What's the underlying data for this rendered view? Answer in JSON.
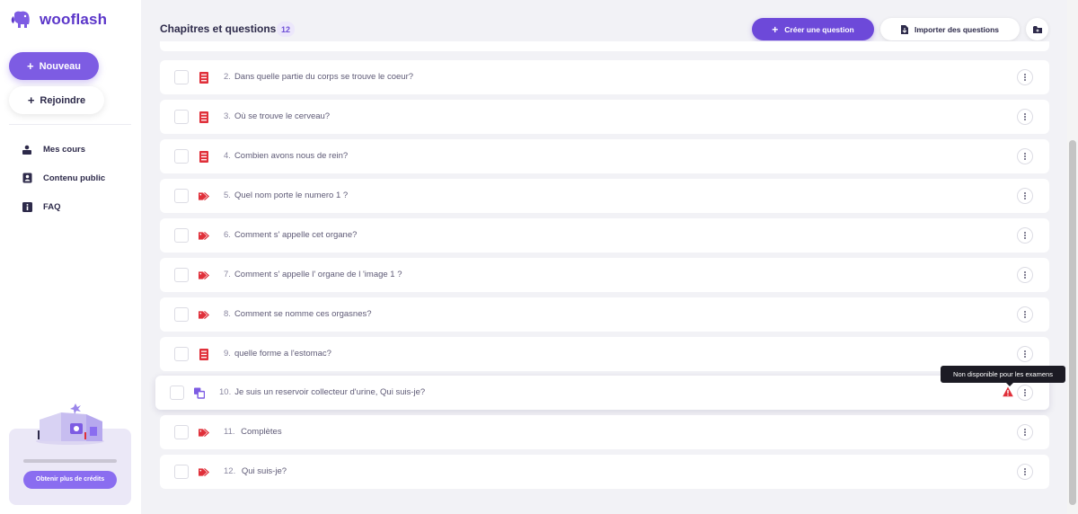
{
  "app": {
    "name": "wooflash"
  },
  "sidebar": {
    "new_button": "Nouveau",
    "join_button": "Rejoindre",
    "nav": [
      {
        "label": "Mes cours",
        "icon": "graduation-cap-icon"
      },
      {
        "label": "Contenu public",
        "icon": "address-book-icon"
      },
      {
        "label": "FAQ",
        "icon": "info-icon"
      }
    ],
    "credits": {
      "button": "Obtenir plus de crédits",
      "progress": 1.0
    }
  },
  "header": {
    "title": "Chapitres et questions",
    "count": "12",
    "create_button": "Créer une question",
    "import_button": "Importer des questions"
  },
  "questions": [
    {
      "num": "2.",
      "text": "Dans quelle partie du corps se trouve le coeur?",
      "type": "list-icon"
    },
    {
      "num": "3.",
      "text": "Où se trouve le cerveau?",
      "type": "list-icon"
    },
    {
      "num": "4.",
      "text": "Combien avons nous de rein?",
      "type": "list-icon"
    },
    {
      "num": "5.",
      "text": "Quel nom porte le numero 1 ?",
      "type": "tag-icon"
    },
    {
      "num": "6.",
      "text": "Comment s' appelle cet organe?",
      "type": "tag-icon"
    },
    {
      "num": "7.",
      "text": "Comment s' appelle l' organe de l 'image 1 ?",
      "type": "tag-icon"
    },
    {
      "num": "8.",
      "text": "Comment se nomme ces orgasnes?",
      "type": "tag-icon"
    },
    {
      "num": "9.",
      "text": "quelle forme a l'estomac?",
      "type": "list-icon"
    },
    {
      "num": "10.",
      "text": "Je suis un reservoir collecteur d'urine, Qui suis-je?",
      "type": "copy-icon",
      "warning": true
    },
    {
      "num": "11.",
      "text": " Complètes",
      "type": "tag-icon"
    },
    {
      "num": "12.",
      "text": " Qui suis-je?",
      "type": "tag-icon"
    }
  ],
  "tooltip": "Non disponible pour les examens",
  "colors": {
    "accent": "#6d49d9",
    "red": "#e0303a",
    "purple_icon": "#7d5ce3"
  }
}
